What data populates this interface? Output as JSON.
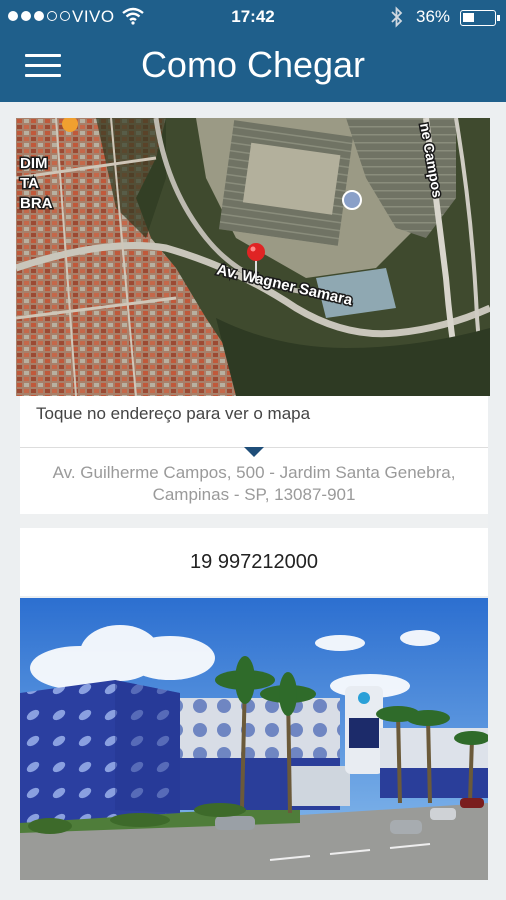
{
  "status_bar": {
    "carrier": "VIVO",
    "time": "17:42",
    "battery_percent": "36%",
    "signal_bars": 3,
    "signal_total": 5,
    "battery_level": 0.36,
    "icons": [
      "signal-icon",
      "wifi-icon",
      "bluetooth-icon",
      "battery-icon"
    ]
  },
  "header": {
    "title": "Como Chegar",
    "menu_icon": "hamburger-menu-icon",
    "background_color": "#1f5f8b"
  },
  "map": {
    "road_labels": [
      "Av. Wagner Samara",
      "ne Campos"
    ],
    "district_labels": [
      "DIM",
      "TA",
      "BRA"
    ],
    "pin_icon": "map-pin-icon",
    "pin_color": "#e02424"
  },
  "address_card": {
    "hint": "Toque no endereço para ver o mapa",
    "address_line1": "Av. Guilherme Campos, 500 - Jardim Santa Genebra,",
    "address_line2": "Campinas - SP, 13087-901"
  },
  "phone": {
    "number": "19 997212000"
  }
}
